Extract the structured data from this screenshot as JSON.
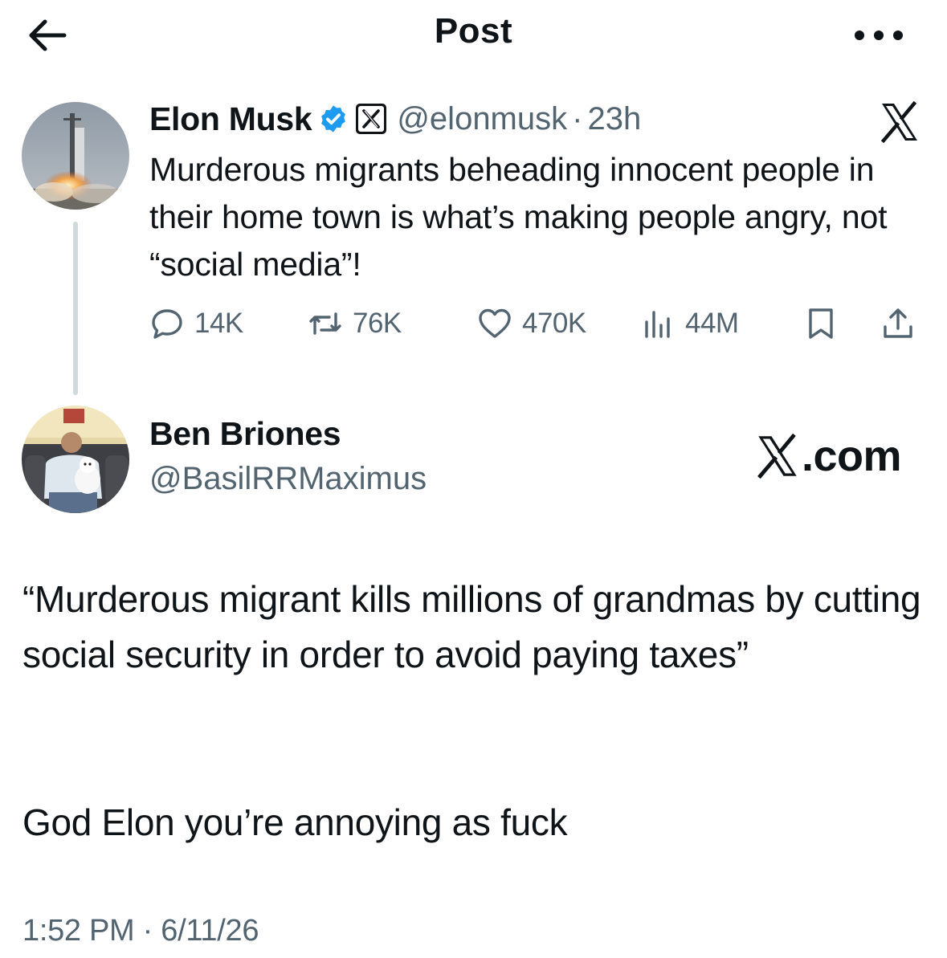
{
  "header": {
    "title": "Post",
    "back_icon": "arrow-left-icon",
    "more_icon": "more-horizontal-icon"
  },
  "tweet": {
    "author_name": "Elon Musk",
    "verified_icon": "verified-badge-icon",
    "affiliate_icon": "x-affiliate-badge-icon",
    "handle": "@elonmusk",
    "separator": "·",
    "time_ago": "23h",
    "platform_icon": "x-logo-icon",
    "text": "Murderous migrants beheading innocent people in their home town is what’s making people angry, not “social media”!",
    "actions": {
      "replies": "14K",
      "reposts": "76K",
      "likes": "470K",
      "views": "44M"
    }
  },
  "reply": {
    "author_name": "Ben Briones",
    "handle": "@BasilRRMaximus",
    "watermark": ".com",
    "text_quote": "“Murderous migrant kills millions of grandmas by cutting social security in order to avoid paying taxes”",
    "text_comment": "God Elon you’re annoying as fuck",
    "posted_at": "1:52 PM · 6/11/26"
  },
  "colors": {
    "text_primary": "#0f1419",
    "text_secondary": "#536471",
    "verified_blue": "#1d9bf0",
    "thread_line": "#cfd9de",
    "background": "#ffffff"
  }
}
